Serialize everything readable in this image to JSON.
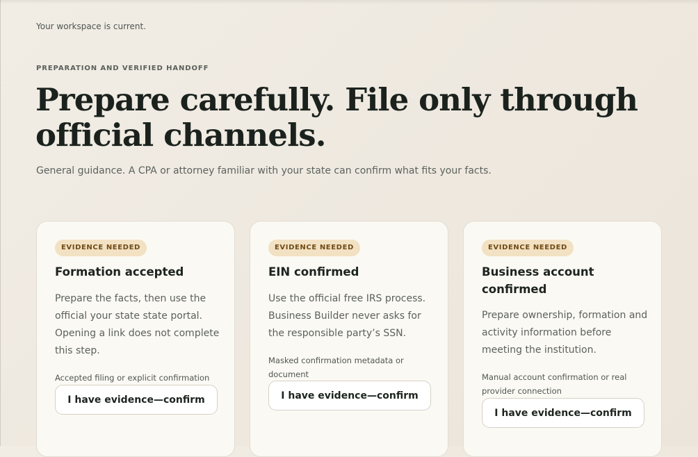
{
  "status_text": "Your workspace is current.",
  "eyebrow": "PREPARATION AND VERIFIED HANDOFF",
  "headline": "Prepare carefully. File only through official channels.",
  "subtitle": "General guidance. A CPA or attorney familiar with your state can confirm what fits your facts.",
  "colors": {
    "page_background": "#efe9e0",
    "card_background": "#fbf9f3",
    "badge_background": "#f2e1c2",
    "badge_text": "#6f4a17",
    "heading_text": "#1b221d"
  },
  "cards": [
    {
      "badge": "EVIDENCE NEEDED",
      "title": "Formation accepted",
      "body": "Prepare the facts, then use the official your state state portal. Opening a link does not complete this step.",
      "evidence": "Accepted filing or explicit confirmation",
      "button_label": "I have evidence—confirm"
    },
    {
      "badge": "EVIDENCE NEEDED",
      "title": "EIN confirmed",
      "body": "Use the official free IRS process. Business Builder never asks for the responsible party’s SSN.",
      "evidence": "Masked confirmation metadata or document",
      "button_label": "I have evidence—confirm"
    },
    {
      "badge": "EVIDENCE NEEDED",
      "title": "Business account confirmed",
      "body": "Prepare ownership, formation and activity information before meeting the institution.",
      "evidence": "Manual account confirmation or real provider connection",
      "button_label": "I have evidence—confirm"
    }
  ]
}
